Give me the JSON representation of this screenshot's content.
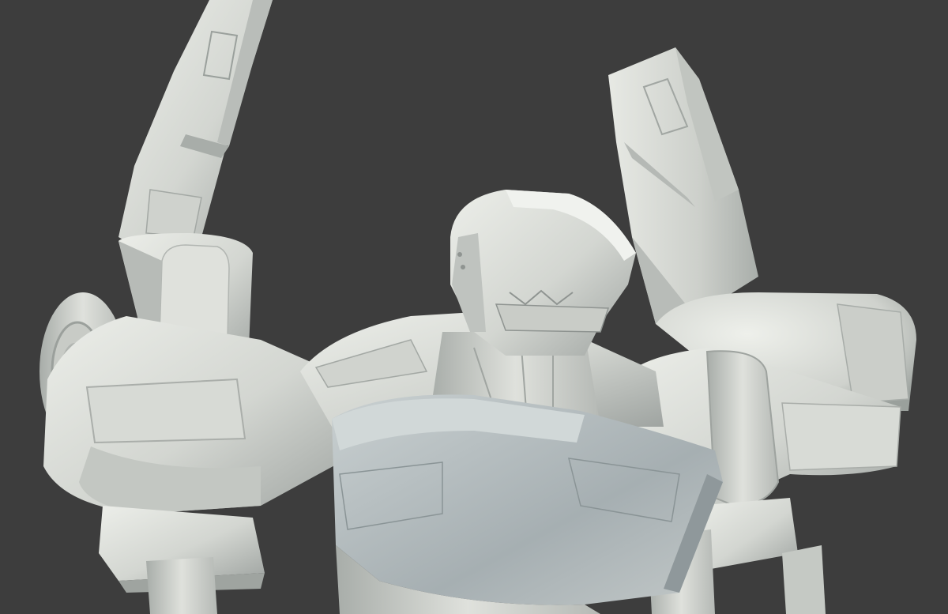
{
  "scene": {
    "background_color": "#3d3d3d",
    "subject": "robot-mech-sculpt",
    "material_light": "#e6e8e4",
    "material_mid": "#c7cac5",
    "material_shadow": "#8e9390",
    "chest_tint": "#a9b3b6"
  }
}
